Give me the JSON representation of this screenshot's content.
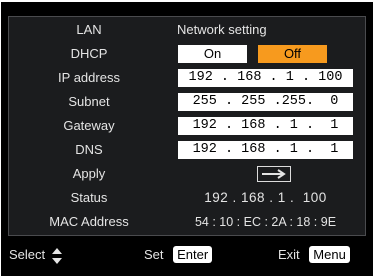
{
  "header": {
    "section_label": "LAN",
    "title": "Network setting"
  },
  "rows": [
    {
      "label": "DHCP",
      "options": [
        "On",
        "Off"
      ],
      "selected": "Off"
    },
    {
      "label": "IP address",
      "value": "192 . 168 . 1 . 100"
    },
    {
      "label": "Subnet",
      "value": "255 . 255 .255.  0"
    },
    {
      "label": "Gateway",
      "value": "192 . 168 . 1 .  1"
    },
    {
      "label": "DNS",
      "value": "192 . 168 . 1 .  1"
    },
    {
      "label": "Apply",
      "icon": "enter-arrow-icon"
    },
    {
      "label": "Status",
      "value": "192 . 168 . 1 .  100"
    },
    {
      "label": "MAC Address",
      "value": "54 : 10 : EC : 2A : 18 : 9E"
    }
  ],
  "footer": {
    "select_label": "Select",
    "select_icon": "up-down-arrows-icon",
    "set_label": "Set",
    "set_key": "Enter",
    "exit_label": "Exit",
    "exit_key": "Menu"
  },
  "colors": {
    "accent": "#f79a1e",
    "panel": "#1b1c1e",
    "field": "#ffffff"
  }
}
